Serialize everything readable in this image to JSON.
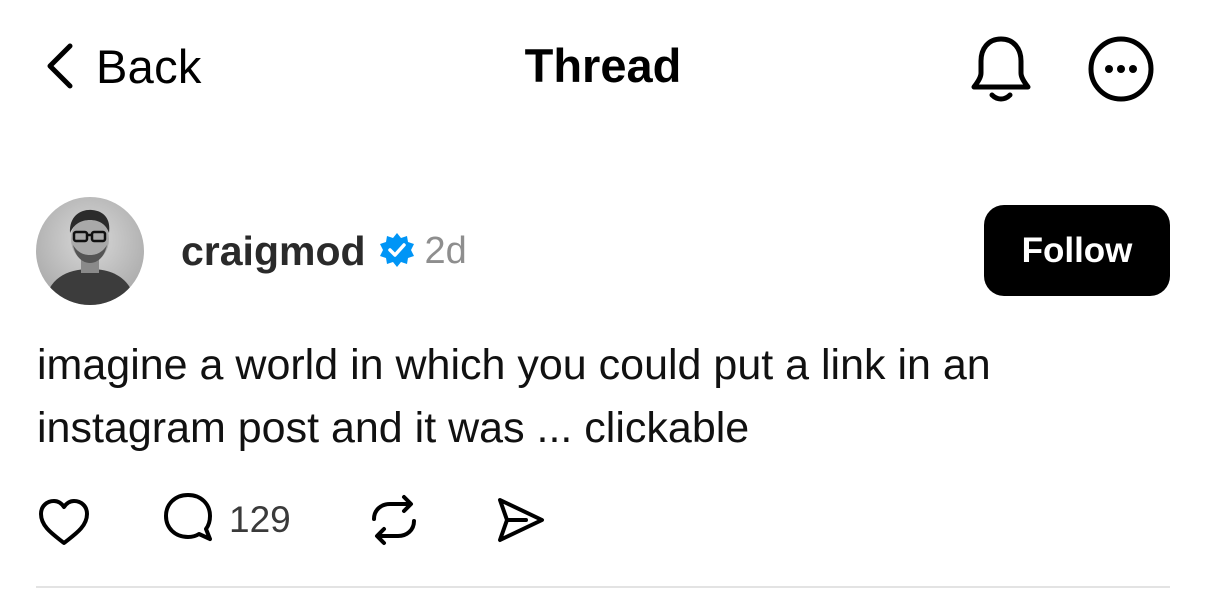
{
  "header": {
    "back_label": "Back",
    "title": "Thread",
    "icons": [
      "chevron-left-icon",
      "bell-icon",
      "more-icon"
    ]
  },
  "post": {
    "username": "craigmod",
    "verified": true,
    "timestamp": "2d",
    "follow_label": "Follow",
    "text": "imagine a world in which you could put a link in an instagram post and it was ... clickable",
    "actions": {
      "comment_count": "129",
      "icons": [
        "heart-icon",
        "comment-icon",
        "repost-icon",
        "share-icon"
      ]
    }
  },
  "colors": {
    "background": "#ffffff",
    "text": "#000000",
    "muted": "#8e8e8e",
    "verified_blue": "#0095f6",
    "button_bg": "#000000",
    "button_text": "#ffffff",
    "divider": "#e3e3e3"
  }
}
